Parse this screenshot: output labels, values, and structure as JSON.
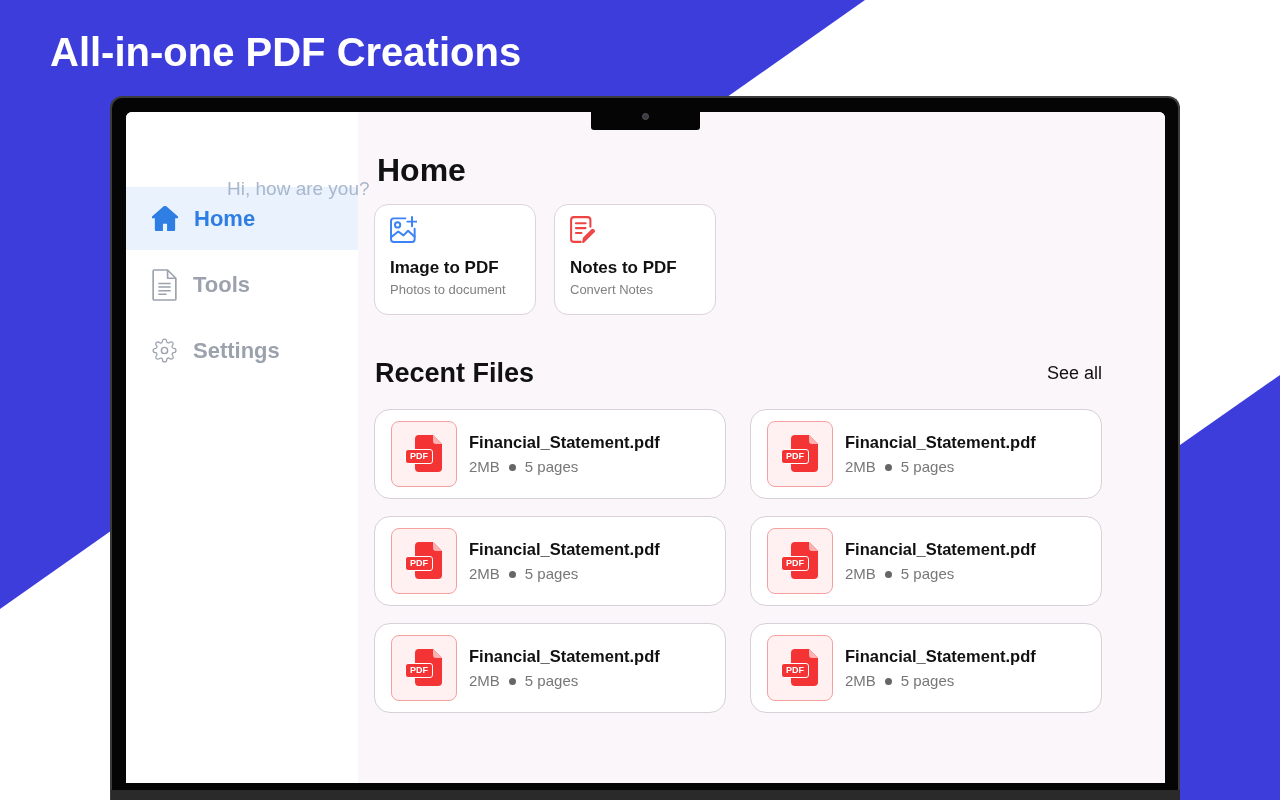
{
  "headline": "All-in-one PDF Creations",
  "greeting": "Hi, how are you?",
  "sidebar": {
    "items": [
      {
        "label": "Home",
        "selected": true
      },
      {
        "label": "Tools",
        "selected": false
      },
      {
        "label": "Settings",
        "selected": false
      }
    ]
  },
  "home": {
    "title": "Home",
    "actions": [
      {
        "title": "Image to PDF",
        "subtitle": "Photos to document"
      },
      {
        "title": "Notes to PDF",
        "subtitle": "Convert Notes"
      }
    ]
  },
  "recent_files": {
    "title": "Recent Files",
    "see_all": "See all",
    "files": [
      {
        "name": "Financial_Statement.pdf",
        "type_label": "PDF",
        "size": "2MB",
        "pages": "5 pages"
      },
      {
        "name": "Financial_Statement.pdf",
        "type_label": "PDF",
        "size": "2MB",
        "pages": "5 pages"
      },
      {
        "name": "Financial_Statement.pdf",
        "type_label": "PDF",
        "size": "2MB",
        "pages": "5 pages"
      },
      {
        "name": "Financial_Statement.pdf",
        "type_label": "PDF",
        "size": "2MB",
        "pages": "5 pages"
      },
      {
        "name": "Financial_Statement.pdf",
        "type_label": "PDF",
        "size": "2MB",
        "pages": "5 pages"
      },
      {
        "name": "Financial_Statement.pdf",
        "type_label": "PDF",
        "size": "2MB",
        "pages": "5 pages"
      }
    ]
  }
}
